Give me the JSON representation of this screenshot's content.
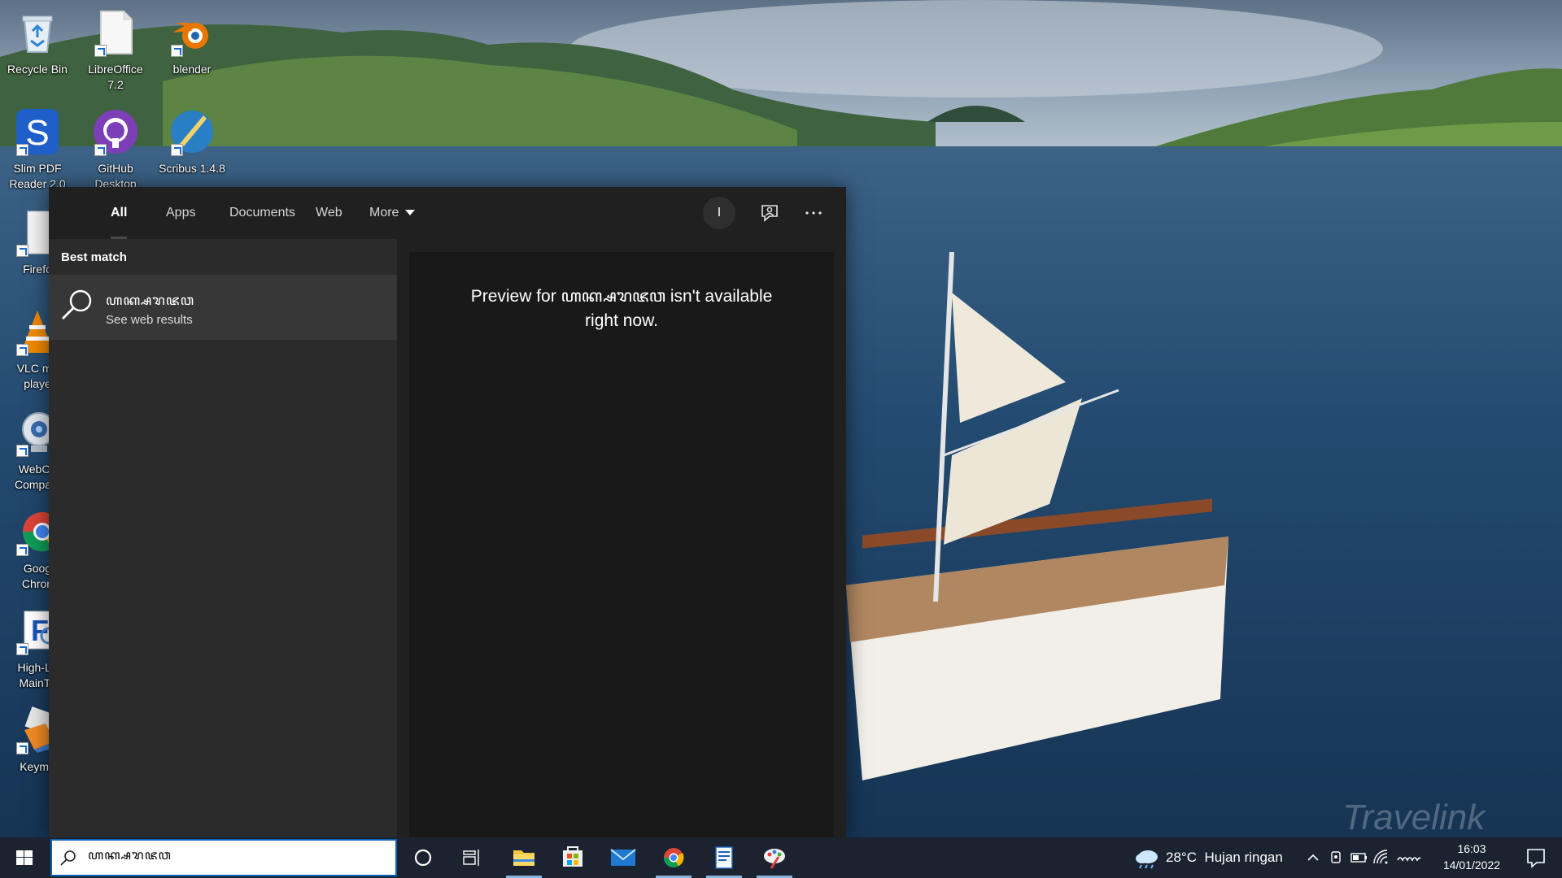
{
  "desktop": {
    "icons": [
      {
        "label": "Recycle Bin",
        "icon": "recycle-bin-icon"
      },
      {
        "label": "LibreOffice\n7.2",
        "icon": "libreoffice-icon"
      },
      {
        "label": "blender",
        "icon": "blender-icon"
      },
      {
        "label": "Slim PDF\nReader 2.0",
        "icon": "slim-pdf-icon"
      },
      {
        "label": "GitHub\nDesktop",
        "icon": "github-icon"
      },
      {
        "label": "Scribus 1.4.8",
        "icon": "scribus-icon"
      },
      {
        "label": "Firefo",
        "icon": "firefox-icon"
      },
      {
        "label": "VLC me\nplaye",
        "icon": "vlc-icon"
      },
      {
        "label": "WebCa\nCompani",
        "icon": "webcam-icon"
      },
      {
        "label": "Goog\nChron",
        "icon": "chrome-icon"
      },
      {
        "label": "High-Lo\nMainTy",
        "icon": "maintype-icon"
      },
      {
        "label": "Keyma",
        "icon": "keyman-icon"
      }
    ],
    "watermark": "Travelink"
  },
  "search": {
    "tabs": [
      {
        "label": "All",
        "active": true
      },
      {
        "label": "Apps",
        "active": false
      },
      {
        "label": "Documents",
        "active": false
      },
      {
        "label": "Web",
        "active": false
      },
      {
        "label": "More",
        "active": false
      }
    ],
    "avatar_letter": "I",
    "best_match_title": "Best match",
    "best_match": {
      "title": "ꦲꦏ꧀ꦱꦫꦗꦮ",
      "subtitle": "See web results",
      "icon": "search-icon"
    },
    "preview": {
      "line1": "Preview for ꦲꦏ꧀ꦱꦫꦗꦮ isn't available",
      "line2": "right now."
    }
  },
  "taskbar": {
    "search_value": "ꦲꦏ꧀ꦱꦫꦗꦮ",
    "apps": [
      {
        "name": "cortana",
        "icon": "cortana-icon"
      },
      {
        "name": "task-view",
        "icon": "task-view-icon"
      },
      {
        "name": "file-explorer",
        "icon": "folder-icon",
        "active": true
      },
      {
        "name": "microsoft-store",
        "icon": "store-icon"
      },
      {
        "name": "mail",
        "icon": "mail-icon"
      },
      {
        "name": "chrome",
        "icon": "chrome-icon",
        "active": true
      },
      {
        "name": "notepad",
        "icon": "document-icon",
        "active": true
      },
      {
        "name": "paint",
        "icon": "paint-icon",
        "active": true
      }
    ],
    "weather": {
      "temp": "28°C",
      "desc": "Hujan ringan",
      "icon": "cloud-rain-icon"
    },
    "time": "16:03",
    "date": "14/01/2022"
  },
  "colors": {
    "panel_bg": "#202020",
    "results_bg": "#2b2b2b",
    "selected_bg": "#373737",
    "preview_bg": "#191919",
    "taskbar_bg": "#1b2330",
    "accent": "#0c63b8"
  }
}
